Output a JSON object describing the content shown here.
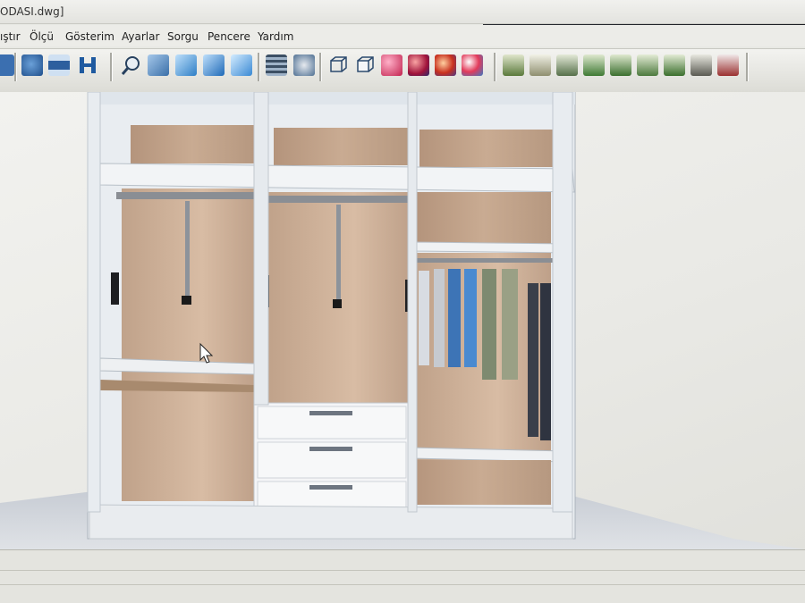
{
  "window": {
    "title": "ODASI.dwg]"
  },
  "menu": {
    "items": [
      "ıştır",
      "Ölçü",
      "Gösterim",
      "Ayarlar",
      "Sorgu",
      "Pencere",
      "Yardım"
    ]
  },
  "toolbar": {
    "buttons": [
      {
        "name": "arrow-icon"
      },
      {
        "name": "camera-icon"
      },
      {
        "name": "measure-icon"
      },
      {
        "name": "h-profile-icon"
      },
      {
        "name": "zoom-icon"
      },
      {
        "name": "view-front-icon"
      },
      {
        "name": "view-top-icon"
      },
      {
        "name": "view-iso-icon"
      },
      {
        "name": "view-side-icon"
      },
      {
        "name": "layers-icon"
      },
      {
        "name": "render-icon"
      },
      {
        "name": "wireframe-icon"
      },
      {
        "name": "hidden-line-icon"
      },
      {
        "name": "shade-icon"
      },
      {
        "name": "material-icon"
      },
      {
        "name": "texture-icon"
      },
      {
        "name": "lights-icon"
      },
      {
        "name": "cabinet-icon"
      },
      {
        "name": "shelf-icon"
      },
      {
        "name": "panel-icon"
      },
      {
        "name": "door-icon"
      },
      {
        "name": "cover-icon"
      },
      {
        "name": "frame-icon"
      },
      {
        "name": "module-icon"
      },
      {
        "name": "tools-icon"
      },
      {
        "name": "export-icon"
      }
    ]
  },
  "model": {
    "type": "wardrobe-3d-view"
  }
}
